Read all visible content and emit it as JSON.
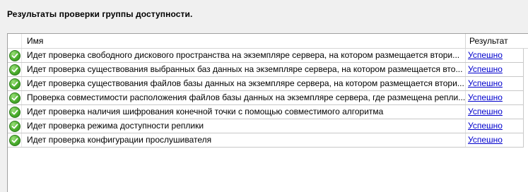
{
  "page_title": "Результаты проверки группы доступности.",
  "columns": {
    "name": "Имя",
    "result": "Результат"
  },
  "rows": [
    {
      "name": "Идет проверка свободного дискового пространства на экземпляре сервера, на котором размещается втори...",
      "result": "Успешно",
      "icon": "success-check-icon"
    },
    {
      "name": "Идет проверка существования выбранных баз данных на экземпляре сервера, на котором размещается вто...",
      "result": "Успешно",
      "icon": "success-check-icon"
    },
    {
      "name": "Идет проверка существования файлов базы данных на экземпляре сервера, на котором размещается втори...",
      "result": "Успешно",
      "icon": "success-check-icon"
    },
    {
      "name": "Проверка совместимости расположения файлов базы данных на экземпляре сервера, где размещена репли...",
      "result": "Успешно",
      "icon": "success-check-icon"
    },
    {
      "name": "Идет проверка наличия шифрования конечной точки с помощью совместимого алгоритма",
      "result": "Успешно",
      "icon": "success-check-icon"
    },
    {
      "name": "Идет проверка режима доступности реплики",
      "result": "Успешно",
      "icon": "success-check-icon"
    },
    {
      "name": "Идет проверка конфигурации прослушивателя",
      "result": "Успешно",
      "icon": "success-check-icon"
    }
  ]
}
